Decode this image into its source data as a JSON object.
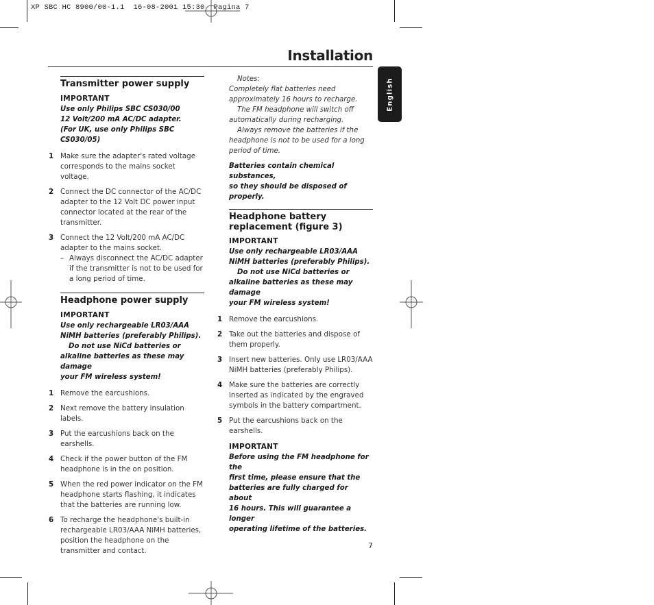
{
  "slug": "XP SBC HC 8900/00-1.1  16-08-2001 15:30  Pagina 7",
  "page": {
    "title": "Installation",
    "language_tab": "English",
    "page_number": "7"
  },
  "sections": [
    {
      "heading": "Transmitter power supply",
      "important_label": "IMPORTANT",
      "important_lines": [
        "Use only Philips SBC CS030/00",
        "12 Volt/200 mA AC/DC adapter.",
        "(For UK, use only Philips SBC CS030/05)"
      ],
      "steps": [
        {
          "num": "1",
          "text": "Make sure the adapter's rated voltage corresponds to the mains socket voltage."
        },
        {
          "num": "2",
          "text": "Connect the DC connector of the AC/DC adapter to the 12 Volt DC power input connector located at the rear of the transmitter."
        },
        {
          "num": "3",
          "text": "Connect the 12 Volt/200 mA AC/DC adapter to the mains socket.",
          "sub": "Always disconnect the AC/DC adapter if the transmitter is not to be used for a long period of time."
        }
      ]
    },
    {
      "heading": "Headphone power supply",
      "important_label": "IMPORTANT",
      "important_lines": [
        "Use only rechargeable LR03/AAA",
        "NiMH batteries (preferably Philips).",
        "Do not use NiCd batteries or",
        "alkaline batteries as these may damage",
        "your FM wireless system!"
      ],
      "steps": [
        {
          "num": "1",
          "text": "Remove the earcushions."
        },
        {
          "num": "2",
          "text": "Next remove the battery insulation labels."
        },
        {
          "num": "3",
          "text": "Put the earcushions back on the earshells."
        },
        {
          "num": "4",
          "text": "Check if the power button of the FM headphone is in the on position."
        },
        {
          "num": "5",
          "text": "When the red power indicator on the FM headphone starts flashing, it indicates that the batteries are running low."
        },
        {
          "num": "6",
          "text": "To recharge the headphone's built-in rechargeable LR03/AAA NiMH batteries, position the headphone on the transmitter and contact."
        }
      ]
    },
    {
      "notes_label": "Notes:",
      "notes": [
        "Completely flat batteries need approximately 16 hours to recharge.",
        "The FM headphone will switch off automatically during recharging.",
        "Always remove the batteries if the headphone is not to be used for a long period of time."
      ],
      "warning_lines": [
        "Batteries contain chemical substances,",
        "so they should be disposed of properly."
      ]
    },
    {
      "heading_lines": [
        "Headphone battery",
        "replacement (figure 3)"
      ],
      "important_label": "IMPORTANT",
      "important_lines": [
        "Use only rechargeable LR03/AAA",
        "NiMH batteries (preferably Philips).",
        "Do not use NiCd batteries or",
        "alkaline batteries as these may damage",
        "your FM wireless system!"
      ],
      "steps": [
        {
          "num": "1",
          "text": "Remove the earcushions."
        },
        {
          "num": "2",
          "text": "Take out the batteries and dispose of them properly."
        },
        {
          "num": "3",
          "text": "Insert new batteries. Only use LR03/AAA NiMH batteries (preferably Philips)."
        },
        {
          "num": "4",
          "text": "Make sure the batteries are correctly inserted as indicated by the engraved symbols in the battery compartment."
        },
        {
          "num": "5",
          "text": "Put the earcushions back on the earshells."
        }
      ],
      "final_important_label": "IMPORTANT",
      "final_important_lines": [
        "Before using the FM headphone for the",
        "first time, please ensure that the",
        "batteries are fully charged for about",
        "16 hours. This will guarantee a longer",
        "operating lifetime of the batteries."
      ]
    }
  ]
}
